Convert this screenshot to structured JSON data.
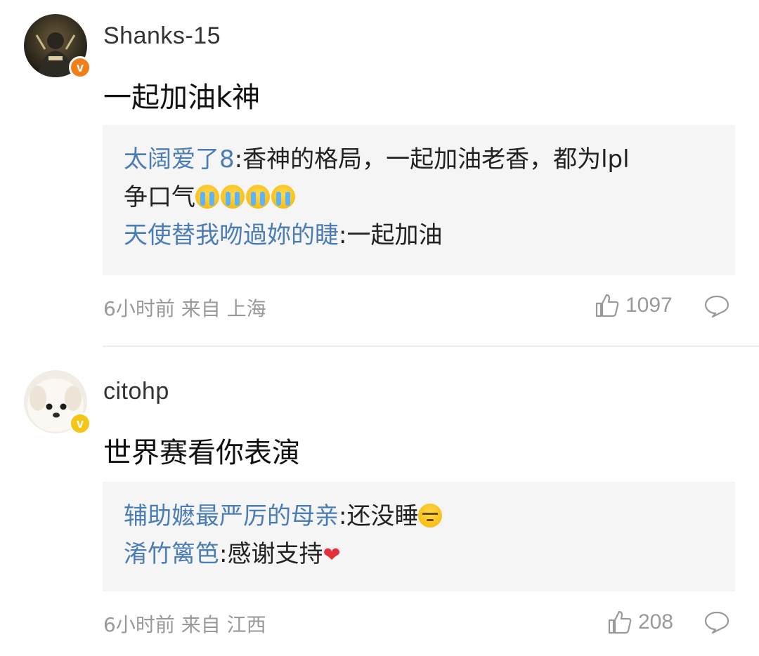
{
  "comments": [
    {
      "username": "Shanks-15",
      "badge_color": "#f07f1a",
      "text": "一起加油k神",
      "replies": [
        {
          "user": "太阔爱了8",
          "text": ":香神的格局，一起加油老香，都为lpl",
          "cont": "争口气",
          "emojis": [
            "cry",
            "cry",
            "cry",
            "cry"
          ]
        },
        {
          "user": "天使替我吻過妳的睫",
          "text": ":一起加油"
        }
      ],
      "time": "6小时前",
      "from": "来自 上海",
      "likes": "1097"
    },
    {
      "username": "citohp",
      "badge_color": "#f5c518",
      "text": "世界赛看你表演",
      "replies": [
        {
          "user": "辅助嬷最严厉的母亲",
          "text": ":还没睡",
          "emoji": "sleepy"
        },
        {
          "user": "淆竹篱笆",
          "text": ":感谢支持",
          "emoji": "heart"
        }
      ],
      "time": "6小时前",
      "from": "来自 江西",
      "likes": "208"
    }
  ],
  "icons": {
    "like": "thumbs-up-icon",
    "comment": "comment-bubble-icon",
    "verified": "verified-v-badge-icon"
  },
  "colors": {
    "reply_user": "#4a7db5",
    "reply_bg": "#f5f5f5",
    "meta": "#999999"
  }
}
